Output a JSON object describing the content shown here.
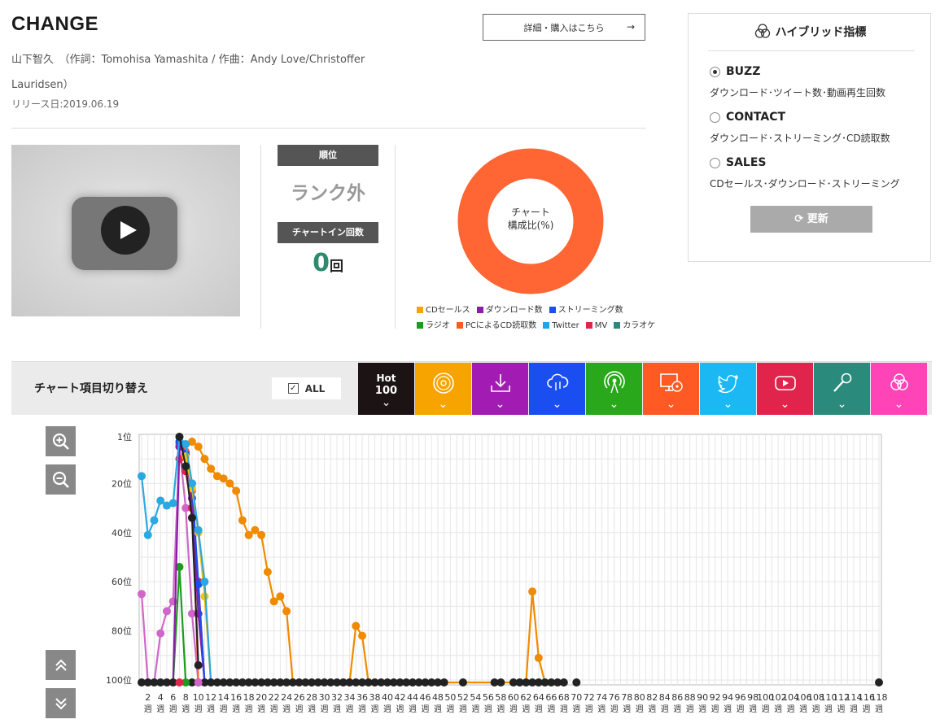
{
  "song": {
    "title": "CHANGE",
    "credits": "山下智久　（作詞：Tomohisa Yamashita / 作曲：Andy Love/Christoffer Lauridsen）",
    "release": "リリース日:2019.06.19",
    "buy_label": "詳細・購入はこちら",
    "buy_arrow": "→"
  },
  "rank": {
    "rank_header": "順位",
    "rank_value": "ランク外",
    "chartin_header": "チャートイン回数",
    "chartin_value": "0",
    "chartin_unit": "回"
  },
  "donut": {
    "center_line1": "チャート",
    "center_line2": "構成比(%)",
    "ring_color": "#ff6633",
    "legend": [
      {
        "label": "CDセールス",
        "color": "#f7a400"
      },
      {
        "label": "ダウンロード数",
        "color": "#8a1ca8"
      },
      {
        "label": "ストリーミング数",
        "color": "#1a4ef0"
      },
      {
        "label": "ラジオ",
        "color": "#1c9c1c"
      },
      {
        "label": "PCによるCD読取数",
        "color": "#ff5a24"
      },
      {
        "label": "Twitter",
        "color": "#1ca8e8"
      },
      {
        "label": "MV",
        "color": "#e0244c"
      },
      {
        "label": "カラオケ",
        "color": "#2a8a7c"
      }
    ]
  },
  "hybrid": {
    "title": "ハイブリッド指標",
    "options": [
      {
        "label": "BUZZ",
        "desc": "ダウンロード･ツイート数･動画再生回数",
        "selected": "true"
      },
      {
        "label": "CONTACT",
        "desc": "ダウンロード･ストリーミング･CD読取数",
        "selected": "false"
      },
      {
        "label": "SALES",
        "desc": "CDセールス･ダウンロード･ストリーミング",
        "selected": "false"
      }
    ],
    "refresh_label": "更新"
  },
  "toggle": {
    "label": "チャート項目切り替え",
    "all_label": "ALL",
    "hot_line1": "Hot",
    "hot_line2": "100",
    "categories": [
      {
        "icon": "hot100-icon",
        "color": "#1c1414"
      },
      {
        "icon": "cd-icon",
        "color": "#f7a400"
      },
      {
        "icon": "download-icon",
        "color": "#a21cb4"
      },
      {
        "icon": "streaming-icon",
        "color": "#1a4ef0"
      },
      {
        "icon": "radio-icon",
        "color": "#2aa81c"
      },
      {
        "icon": "pc-cd-icon",
        "color": "#ff5a24"
      },
      {
        "icon": "twitter-icon",
        "color": "#1cb8f4"
      },
      {
        "icon": "mv-icon",
        "color": "#e0244c"
      },
      {
        "icon": "karaoke-icon",
        "color": "#2a8a7c"
      },
      {
        "icon": "hybrid-icon",
        "color": "#ff44b8"
      }
    ]
  },
  "chart_data": {
    "type": "line",
    "y_labels": [
      "1位",
      "20位",
      "40位",
      "60位",
      "80位",
      "100位"
    ],
    "y_ticks": [
      1,
      20,
      40,
      60,
      80,
      100
    ],
    "ylim": [
      1,
      101
    ],
    "x_unit": "週",
    "x_range": [
      1,
      118
    ],
    "x_tick_step": 2,
    "series": [
      {
        "name": "Hot 100",
        "color": "#222222",
        "points": [
          [
            7,
            1
          ],
          [
            8,
            13
          ],
          [
            9,
            34
          ],
          [
            10,
            94
          ]
        ]
      },
      {
        "name": "CDセールス",
        "color": "#f08a00",
        "points": [
          [
            9,
            3
          ],
          [
            10,
            5
          ],
          [
            11,
            10
          ],
          [
            12,
            14
          ],
          [
            13,
            17
          ],
          [
            14,
            18
          ],
          [
            15,
            20
          ],
          [
            16,
            23
          ],
          [
            17,
            35
          ],
          [
            18,
            41
          ],
          [
            19,
            39
          ],
          [
            20,
            41
          ],
          [
            21,
            56
          ],
          [
            22,
            68
          ],
          [
            23,
            66
          ],
          [
            24,
            72
          ],
          [
            25,
            101
          ],
          [
            34,
            101
          ],
          [
            35,
            78
          ],
          [
            36,
            82
          ],
          [
            37,
            101
          ],
          [
            62,
            101
          ],
          [
            63,
            64
          ],
          [
            64,
            91
          ],
          [
            65,
            101
          ]
        ]
      },
      {
        "name": "ダウンロード数",
        "color": "#8a1ca8",
        "points": [
          [
            6,
            101
          ],
          [
            7,
            5
          ],
          [
            8,
            8
          ],
          [
            9,
            26
          ],
          [
            10,
            73
          ],
          [
            11,
            101
          ]
        ]
      },
      {
        "name": "ストリーミング数",
        "color": "#1a4ef0",
        "points": [
          [
            7,
            3
          ],
          [
            8,
            8
          ],
          [
            9,
            20
          ],
          [
            10,
            61
          ],
          [
            11,
            101
          ]
        ]
      },
      {
        "name": "ラジオ",
        "color": "#1c9c1c",
        "points": [
          [
            6,
            101
          ],
          [
            7,
            54
          ],
          [
            8,
            101
          ]
        ]
      },
      {
        "name": "PCによるCD読取数",
        "color": "#ff6633",
        "points": [
          [
            7,
            4
          ],
          [
            8,
            7
          ],
          [
            9,
            23
          ],
          [
            10,
            101
          ]
        ]
      },
      {
        "name": "Twitter",
        "color": "#2aa8e0",
        "points": [
          [
            1,
            17
          ],
          [
            2,
            41
          ],
          [
            3,
            35
          ],
          [
            4,
            27
          ],
          [
            5,
            29
          ],
          [
            6,
            28
          ],
          [
            7,
            1
          ],
          [
            8,
            4
          ],
          [
            9,
            20
          ],
          [
            10,
            39
          ],
          [
            11,
            60
          ],
          [
            12,
            101
          ]
        ]
      },
      {
        "name": "MV",
        "color": "#e0244c",
        "points": [
          [
            7,
            10
          ],
          [
            8,
            15
          ],
          [
            9,
            30
          ],
          [
            10,
            60
          ],
          [
            11,
            101
          ]
        ]
      },
      {
        "name": "CDセールス(黄)",
        "color": "#f7c400",
        "points": [
          [
            8,
            9
          ],
          [
            9,
            22
          ],
          [
            10,
            40
          ],
          [
            11,
            66
          ],
          [
            12,
            101
          ]
        ]
      },
      {
        "name": "ハイブリッド",
        "color": "#d066c8",
        "points": [
          [
            1,
            65
          ],
          [
            2,
            101
          ],
          [
            3,
            101
          ],
          [
            4,
            81
          ],
          [
            5,
            72
          ],
          [
            6,
            68
          ],
          [
            7,
            5
          ],
          [
            8,
            30
          ],
          [
            9,
            73
          ],
          [
            10,
            101
          ]
        ]
      }
    ],
    "hot100_dropout_weeks": [
      1,
      2,
      3,
      4,
      5,
      6,
      9,
      10,
      11,
      12,
      13,
      14,
      15,
      16,
      17,
      18,
      19,
      20,
      21,
      22,
      23,
      24,
      25,
      26,
      27,
      28,
      29,
      30,
      31,
      32,
      33,
      34,
      35,
      36,
      37,
      38,
      39,
      40,
      41,
      42,
      43,
      44,
      45,
      46,
      47,
      48,
      49,
      52,
      57,
      58,
      60,
      61,
      62,
      63,
      64,
      65,
      66,
      67,
      68,
      70,
      118
    ],
    "grid": true
  }
}
